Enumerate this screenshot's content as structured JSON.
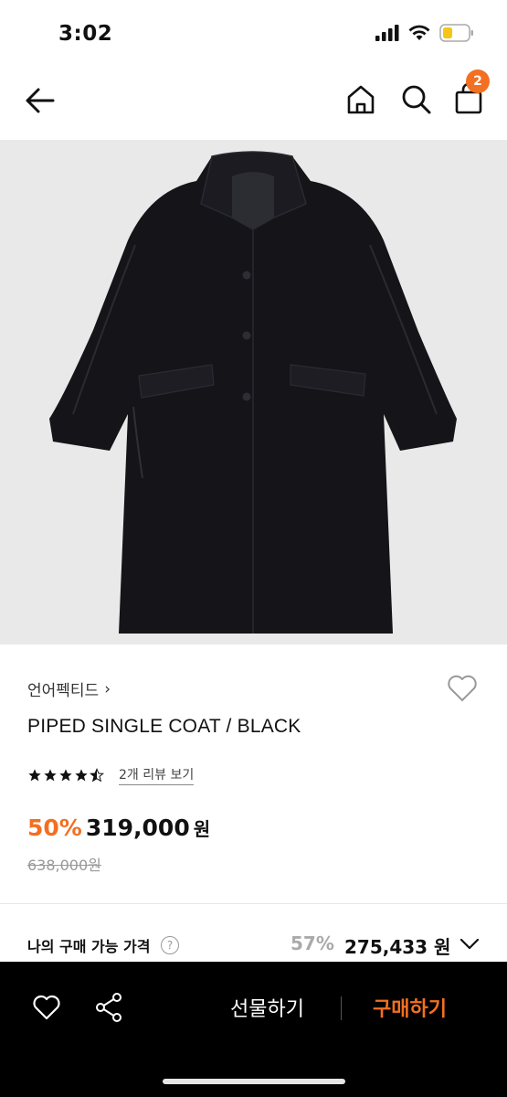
{
  "status_bar": {
    "time": "3:02"
  },
  "nav": {
    "cart_count": "2",
    "icons": [
      "back-arrow-icon",
      "home-icon",
      "search-icon",
      "cart-icon"
    ]
  },
  "product": {
    "image_desc_icon": "black-coat-image",
    "brand": "언어펙티드",
    "brand_chevron": "›",
    "name": "PIPED SINGLE COAT / BLACK",
    "rating": {
      "stars": 4.5,
      "review_link": "2개 리뷰 보기"
    },
    "discount": "50%",
    "price": "319,000",
    "price_unit": "원",
    "original_price": "638,000원"
  },
  "my_price": {
    "label": "나의 구매 가능 가격",
    "help": "?",
    "discount": "57%",
    "price": "275,433 원"
  },
  "bottom_bar": {
    "gift_label": "선물하기",
    "buy_label": "구매하기"
  },
  "colors": {
    "accent": "#f36f21",
    "bottom_bar_bg": "#000000",
    "image_bg": "#e9e9e9"
  }
}
